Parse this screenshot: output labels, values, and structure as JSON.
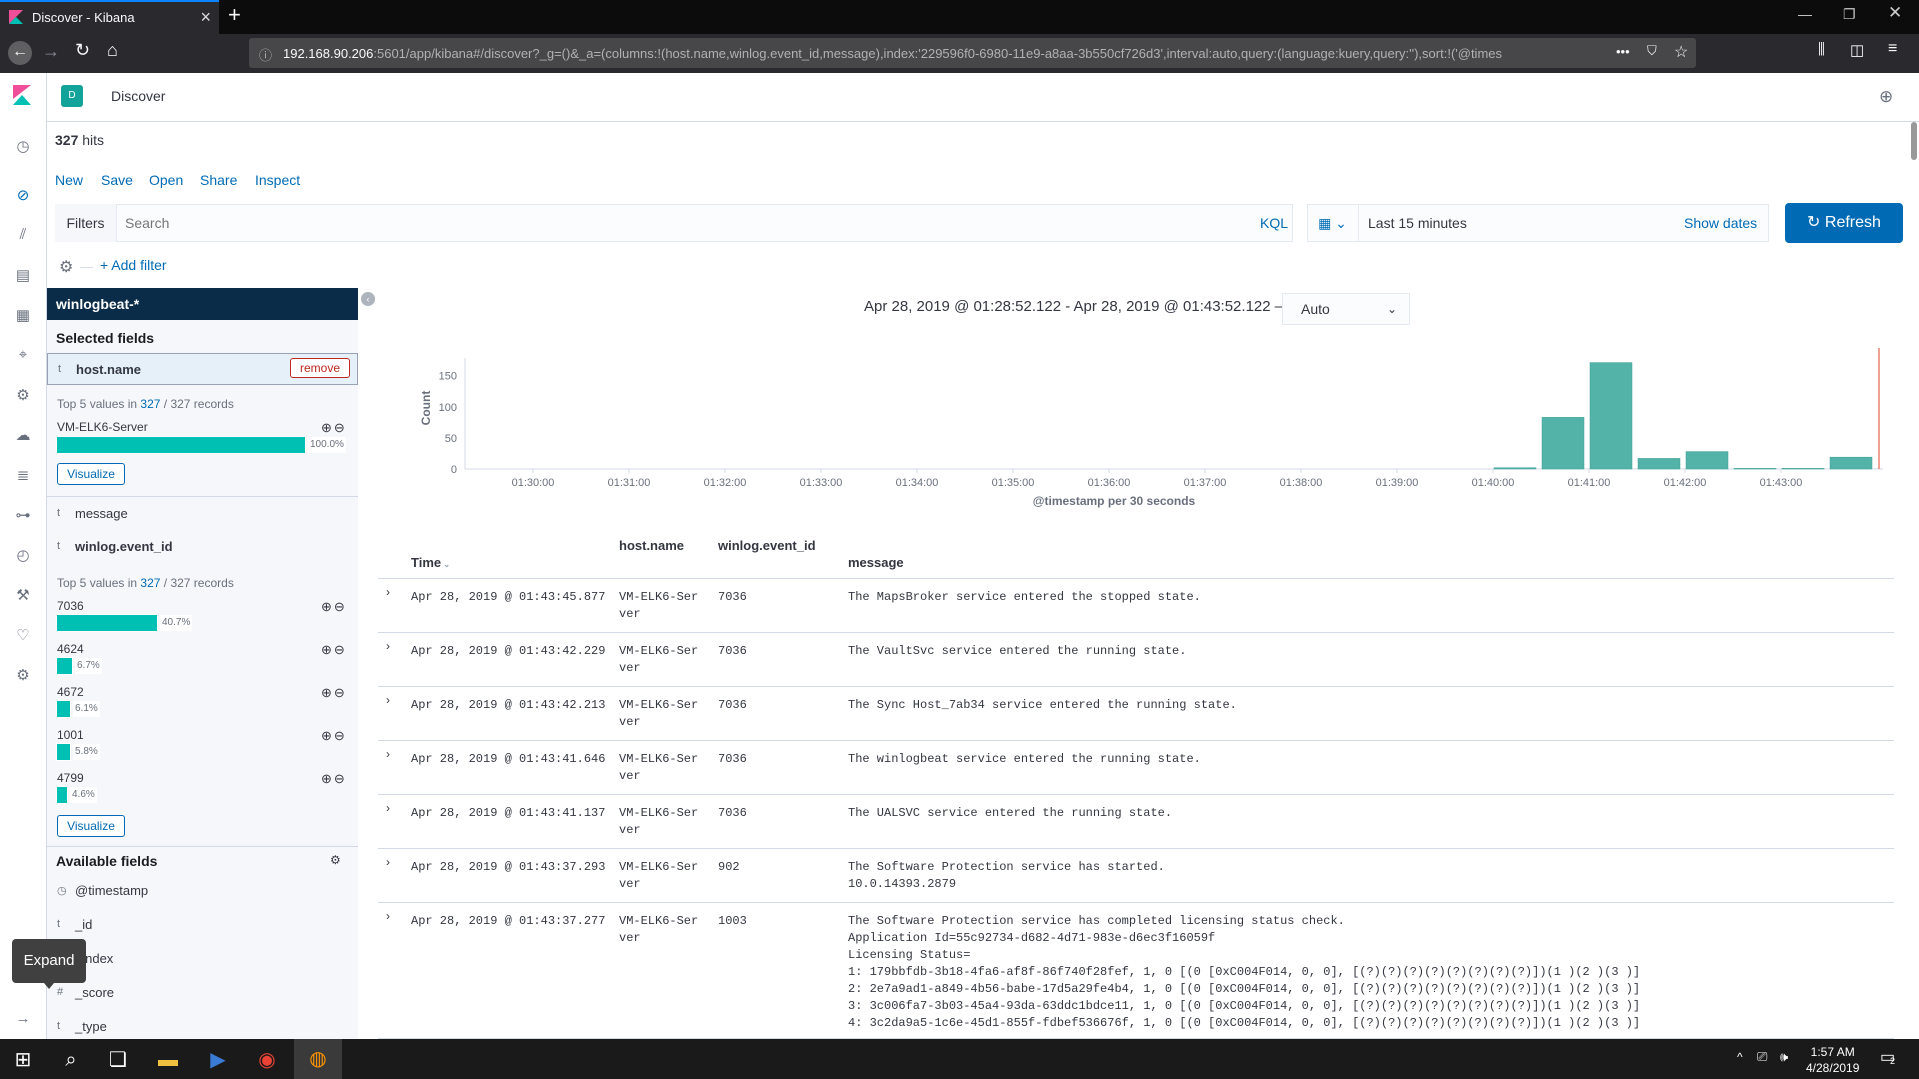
{
  "browser": {
    "tab_title": "Discover - Kibana",
    "url_host": "192.168.90.206",
    "url_rest": ":5601/app/kibana#/discover?_g=()&_a=(columns:!(host.name,winlog.event_id,message),index:'229596f0-6980-11e9-a8aa-3b550cf726d3',interval:auto,query:(language:kuery,query:''),sort:!('@times"
  },
  "kibana": {
    "app_badge": "D",
    "app_title": "Discover",
    "hits_count": "327",
    "hits_label": "hits",
    "menu": [
      "New",
      "Save",
      "Open",
      "Share",
      "Inspect"
    ],
    "filters_label": "Filters",
    "search_placeholder": "Search",
    "kql_label": "KQL",
    "time_range": "Last 15 minutes",
    "show_dates": "Show dates",
    "refresh": "Refresh",
    "add_filter": "+ Add filter"
  },
  "sidebar": {
    "index_pattern": "winlogbeat-*",
    "selected_title": "Selected fields",
    "remove": "remove",
    "top5_prefix": "Top 5 values in",
    "top5_count": "327",
    "top5_suffix": "/ 327 records",
    "visualize": "Visualize",
    "host_values": [
      {
        "name": "VM-ELK6-Server",
        "pct": "100.0%",
        "fraction": 1.0
      }
    ],
    "event_values": [
      {
        "name": "7036",
        "pct": "40.7%",
        "fraction": 0.407
      },
      {
        "name": "4624",
        "pct": "6.7%",
        "fraction": 0.067
      },
      {
        "name": "4672",
        "pct": "6.1%",
        "fraction": 0.061
      },
      {
        "name": "1001",
        "pct": "5.8%",
        "fraction": 0.058
      },
      {
        "name": "4799",
        "pct": "4.6%",
        "fraction": 0.046
      }
    ],
    "selected_fields": [
      {
        "type": "t",
        "name": "host.name"
      },
      {
        "type": "t",
        "name": "message"
      },
      {
        "type": "t",
        "name": "winlog.event_id"
      }
    ],
    "available_title": "Available fields",
    "available_fields": [
      {
        "type": "◷",
        "name": "@timestamp"
      },
      {
        "type": "t",
        "name": "_id"
      },
      {
        "type": "t",
        "name": "_index"
      },
      {
        "type": "#",
        "name": "_score"
      },
      {
        "type": "t",
        "name": "_type"
      }
    ],
    "tooltip": "Expand"
  },
  "histogram": {
    "range_text": "Apr 28, 2019 @ 01:28:52.122 - Apr 28, 2019 @ 01:43:52.122 —",
    "interval": "Auto"
  },
  "chart_data": {
    "type": "bar",
    "title": "",
    "xlabel": "@timestamp per 30 seconds",
    "ylabel": "Count",
    "ylim": [
      0,
      180
    ],
    "yticks": [
      0,
      50,
      100,
      150
    ],
    "xticks": [
      "01:30:00",
      "01:31:00",
      "01:32:00",
      "01:33:00",
      "01:34:00",
      "01:35:00",
      "01:36:00",
      "01:37:00",
      "01:38:00",
      "01:39:00",
      "01:40:00",
      "01:41:00",
      "01:42:00",
      "01:43:00"
    ],
    "categories": [
      "01:40:00",
      "01:40:30",
      "01:41:00",
      "01:41:30",
      "01:42:00",
      "01:42:30",
      "01:43:00",
      "01:43:30"
    ],
    "values": [
      2,
      83,
      171,
      17,
      28,
      1,
      1,
      19
    ],
    "color": "#54b3a8"
  },
  "table": {
    "headers": {
      "time": "Time",
      "host": "host.name",
      "event": "winlog.event_id",
      "message": "message"
    },
    "rows": [
      {
        "time": "Apr 28, 2019 @ 01:43:45.877",
        "host": "VM-ELK6-Ser\nver",
        "event": "7036",
        "message": "The MapsBroker service entered the stopped state."
      },
      {
        "time": "Apr 28, 2019 @ 01:43:42.229",
        "host": "VM-ELK6-Ser\nver",
        "event": "7036",
        "message": "The VaultSvc service entered the running state."
      },
      {
        "time": "Apr 28, 2019 @ 01:43:42.213",
        "host": "VM-ELK6-Ser\nver",
        "event": "7036",
        "message": "The Sync Host_7ab34 service entered the running state."
      },
      {
        "time": "Apr 28, 2019 @ 01:43:41.646",
        "host": "VM-ELK6-Ser\nver",
        "event": "7036",
        "message": "The winlogbeat service entered the running state."
      },
      {
        "time": "Apr 28, 2019 @ 01:43:41.137",
        "host": "VM-ELK6-Ser\nver",
        "event": "7036",
        "message": "The UALSVC service entered the running state."
      },
      {
        "time": "Apr 28, 2019 @ 01:43:37.293",
        "host": "VM-ELK6-Ser\nver",
        "event": "902",
        "message": "The Software Protection service has started.\n10.0.14393.2879"
      },
      {
        "time": "Apr 28, 2019 @ 01:43:37.277",
        "host": "VM-ELK6-Ser\nver",
        "event": "1003",
        "message": "The Software Protection service has completed licensing status check.\nApplication Id=55c92734-d682-4d71-983e-d6ec3f16059f\nLicensing Status=\n1: 179bbfdb-3b18-4fa6-af8f-86f740f28fef, 1, 0 [(0 [0xC004F014, 0, 0], [(?)(?)(?)(?)(?)(?)(?)(?)])(1 )(2 )(3 )]\n2: 2e7a9ad1-a849-4b56-babe-17d5a29fe4b4, 1, 0 [(0 [0xC004F014, 0, 0], [(?)(?)(?)(?)(?)(?)(?)(?)])(1 )(2 )(3 )]\n3: 3c006fa7-3b03-45a4-93da-63ddc1bdce11, 1, 0 [(0 [0xC004F014, 0, 0], [(?)(?)(?)(?)(?)(?)(?)(?)])(1 )(2 )(3 )]\n4: 3c2da9a5-1c6e-45d1-855f-fdbef536676f, 1, 0 [(0 [0xC004F014, 0, 0], [(?)(?)(?)(?)(?)(?)(?)(?)])(1 )(2 )(3 )]"
      }
    ]
  },
  "taskbar": {
    "time": "1:57 AM",
    "date": "4/28/2019",
    "notif_count": "2"
  }
}
